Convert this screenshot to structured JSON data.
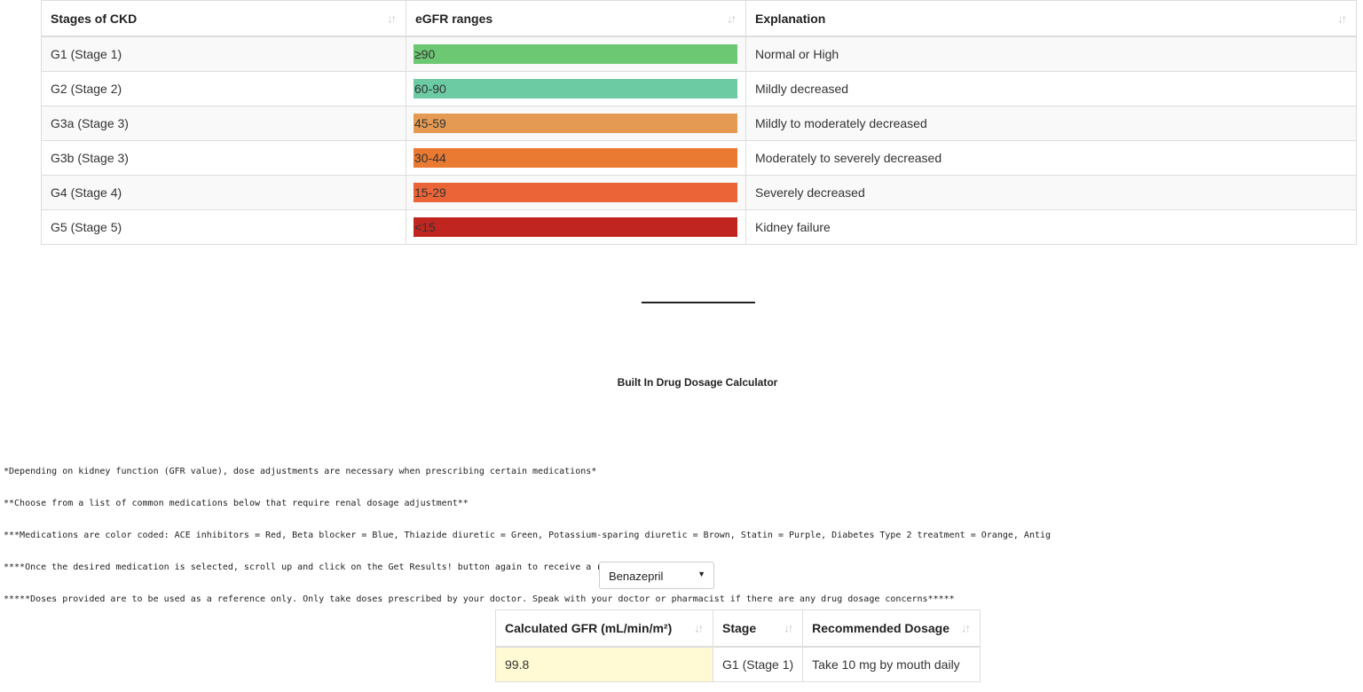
{
  "ckd_table": {
    "headers": [
      "Stages of CKD",
      "eGFR ranges",
      "Explanation"
    ],
    "rows": [
      {
        "stage": "G1 (Stage 1)",
        "range": "≥90",
        "color": "#6cc872",
        "explanation": "Normal or High"
      },
      {
        "stage": "G2 (Stage 2)",
        "range": "60-90",
        "color": "#6ccba3",
        "explanation": "Mildly decreased"
      },
      {
        "stage": "G3a (Stage 3)",
        "range": "45-59",
        "color": "#e49a53",
        "explanation": "Mildly to moderately decreased"
      },
      {
        "stage": "G3b (Stage 3)",
        "range": "30-44",
        "color": "#ea7a32",
        "explanation": "Moderately to severely decreased"
      },
      {
        "stage": "G4 (Stage 4)",
        "range": "15-29",
        "color": "#ea6438",
        "explanation": "Severely decreased"
      },
      {
        "stage": "G5 (Stage 5)",
        "range": "<15",
        "color": "#c0261f",
        "explanation": "Kidney failure"
      }
    ]
  },
  "calculator": {
    "title": "Built In Drug Dosage Calculator",
    "notes": [
      "*Depending on kidney function (GFR value), dose adjustments are necessary when prescribing certain medications*",
      "**Choose from a list of common medications below that require renal dosage adjustment**",
      "***Medications are color coded: ACE inhibitors = Red, Beta blocker = Blue, Thiazide diuretic = Green, Potassium-sparing diuretic = Brown, Statin = Purple, Diabetes Type 2 treatment = Orange, Antig",
      "****Once the desired medication is selected, scroll up and click on the Get Results! button again to receive a recommended dosage****",
      "*****Doses provided are to be used as a reference only. Only take doses prescribed by your doctor. Speak with your doctor or pharmacist if there are any drug dosage concerns*****"
    ],
    "medication_select": {
      "value": "Benazepril",
      "arrow": "▼"
    }
  },
  "results_table": {
    "headers": [
      "Calculated GFR (mL/min/m²)",
      "Stage",
      "Recommended Dosage"
    ],
    "row": {
      "gfr": "99.8",
      "stage": "G1 (Stage 1)",
      "dosage": "Take 10 mg by mouth daily"
    }
  },
  "icons": {
    "sort": "sort-arrows-icon"
  }
}
